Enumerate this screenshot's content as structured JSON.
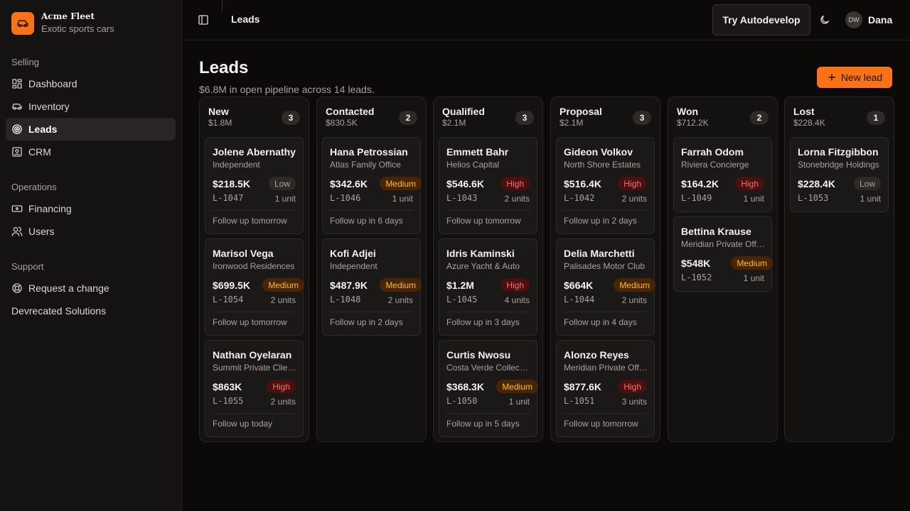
{
  "app": {
    "name": "Acme Fleet",
    "tagline": "Exotic sports cars",
    "logo_icon": "car-icon",
    "accent": "#f97316"
  },
  "sidebar": {
    "sections": [
      {
        "heading": "Selling",
        "items": [
          {
            "label": "Dashboard",
            "icon": "dashboard-icon"
          },
          {
            "label": "Inventory",
            "icon": "car-icon"
          },
          {
            "label": "Leads",
            "icon": "target-icon",
            "active": true
          },
          {
            "label": "CRM",
            "icon": "contact-icon"
          }
        ]
      },
      {
        "heading": "Operations",
        "items": [
          {
            "label": "Financing",
            "icon": "banknote-icon"
          },
          {
            "label": "Users",
            "icon": "users-icon"
          }
        ]
      },
      {
        "heading": "Support",
        "items": [
          {
            "label": "Request a change",
            "icon": "lifebuoy-icon"
          },
          {
            "label": "Devrecated Solutions",
            "icon": ""
          }
        ]
      }
    ]
  },
  "topbar": {
    "title": "Leads",
    "try_button": "Try Autodevelop",
    "user": {
      "initials": "DW",
      "name": "Dana"
    }
  },
  "page": {
    "title": "Leads",
    "subtitle": "$6.8M in open pipeline across 14 leads.",
    "new_button": "New lead"
  },
  "priority_colors": {
    "Low": "#a8a29e",
    "Medium": "#fbbf24",
    "High": "#f87171"
  },
  "columns": [
    {
      "name": "New",
      "total": "$1.8M",
      "count": "3",
      "cards": [
        {
          "name": "Jolene Abernathy",
          "company": "Independent",
          "value": "$218.5K",
          "priority": "Low",
          "id": "L-1047",
          "units": "1 unit",
          "follow": "Follow up tomorrow"
        },
        {
          "name": "Marisol Vega",
          "company": "Ironwood Residences",
          "value": "$699.5K",
          "priority": "Medium",
          "id": "L-1054",
          "units": "2 units",
          "follow": "Follow up tomorrow"
        },
        {
          "name": "Nathan Oyelaran",
          "company": "Summit Private Clients",
          "value": "$863K",
          "priority": "High",
          "id": "L-1055",
          "units": "2 units",
          "follow": "Follow up today"
        }
      ]
    },
    {
      "name": "Contacted",
      "total": "$830.5K",
      "count": "2",
      "cards": [
        {
          "name": "Hana Petrossian",
          "company": "Atlas Family Office",
          "value": "$342.6K",
          "priority": "Medium",
          "id": "L-1046",
          "units": "1 unit",
          "follow": "Follow up in 6 days"
        },
        {
          "name": "Kofi Adjei",
          "company": "Independent",
          "value": "$487.9K",
          "priority": "Medium",
          "id": "L-1048",
          "units": "2 units",
          "follow": "Follow up in 2 days"
        }
      ]
    },
    {
      "name": "Qualified",
      "total": "$2.1M",
      "count": "3",
      "cards": [
        {
          "name": "Emmett Bahr",
          "company": "Helios Capital",
          "value": "$546.6K",
          "priority": "High",
          "id": "L-1043",
          "units": "2 units",
          "follow": "Follow up tomorrow"
        },
        {
          "name": "Idris Kaminski",
          "company": "Azure Yacht & Auto",
          "value": "$1.2M",
          "priority": "High",
          "id": "L-1045",
          "units": "4 units",
          "follow": "Follow up in 3 days"
        },
        {
          "name": "Curtis Nwosu",
          "company": "Costa Verde Collection",
          "value": "$368.3K",
          "priority": "Medium",
          "id": "L-1050",
          "units": "1 unit",
          "follow": "Follow up in 5 days"
        }
      ]
    },
    {
      "name": "Proposal",
      "total": "$2.1M",
      "count": "3",
      "cards": [
        {
          "name": "Gideon Volkov",
          "company": "North Shore Estates",
          "value": "$516.4K",
          "priority": "High",
          "id": "L-1042",
          "units": "2 units",
          "follow": "Follow up in 2 days"
        },
        {
          "name": "Delia Marchetti",
          "company": "Palisades Motor Club",
          "value": "$664K",
          "priority": "Medium",
          "id": "L-1044",
          "units": "2 units",
          "follow": "Follow up in 4 days"
        },
        {
          "name": "Alonzo Reyes",
          "company": "Meridian Private Office",
          "value": "$877.6K",
          "priority": "High",
          "id": "L-1051",
          "units": "3 units",
          "follow": "Follow up tomorrow"
        }
      ]
    },
    {
      "name": "Won",
      "total": "$712.2K",
      "count": "2",
      "cards": [
        {
          "name": "Farrah Odom",
          "company": "Riviera Concierge",
          "value": "$164.2K",
          "priority": "High",
          "id": "L-1049",
          "units": "1 unit",
          "follow": ""
        },
        {
          "name": "Bettina Krause",
          "company": "Meridian Private Office",
          "value": "$548K",
          "priority": "Medium",
          "id": "L-1052",
          "units": "1 unit",
          "follow": ""
        }
      ]
    },
    {
      "name": "Lost",
      "total": "$228.4K",
      "count": "1",
      "cards": [
        {
          "name": "Lorna Fitzgibbon",
          "company": "Stonebridge Holdings",
          "value": "$228.4K",
          "priority": "Low",
          "id": "L-1053",
          "units": "1 unit",
          "follow": ""
        }
      ]
    }
  ]
}
